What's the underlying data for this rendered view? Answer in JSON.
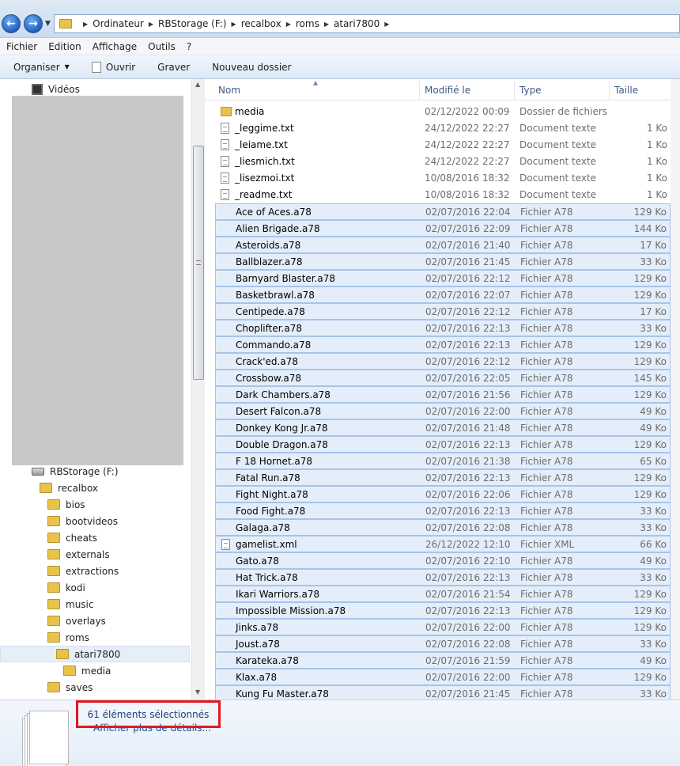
{
  "address": {
    "breadcrumbs": [
      "Ordinateur",
      "RBStorage (F:)",
      "recalbox",
      "roms",
      "atari7800"
    ]
  },
  "menu": [
    "Fichier",
    "Edition",
    "Affichage",
    "Outils",
    "?"
  ],
  "toolbar": {
    "organiser": "Organiser",
    "ouvrir": "Ouvrir",
    "graver": "Graver",
    "nouveau_dossier": "Nouveau dossier"
  },
  "tree": {
    "videos": "Vidéos",
    "drive": "RBStorage (F:)",
    "recalbox": "recalbox",
    "bios": "bios",
    "bootvideos": "bootvideos",
    "cheats": "cheats",
    "externals": "externals",
    "extractions": "extractions",
    "kodi": "kodi",
    "music": "music",
    "overlays": "overlays",
    "roms": "roms",
    "atari7800": "atari7800",
    "media": "media",
    "saves": "saves"
  },
  "columns": {
    "name": "Nom",
    "modified": "Modifié le",
    "type": "Type",
    "size": "Taille"
  },
  "files": [
    {
      "name": "media",
      "date": "02/12/2022 00:09",
      "type": "Dossier de fichiers",
      "size": "",
      "icon": "folder",
      "sel": false
    },
    {
      "name": "_leggime.txt",
      "date": "24/12/2022 22:27",
      "type": "Document texte",
      "size": "1 Ko",
      "icon": "txt",
      "sel": false
    },
    {
      "name": "_leiame.txt",
      "date": "24/12/2022 22:27",
      "type": "Document texte",
      "size": "1 Ko",
      "icon": "txt",
      "sel": false
    },
    {
      "name": "_liesmich.txt",
      "date": "24/12/2022 22:27",
      "type": "Document texte",
      "size": "1 Ko",
      "icon": "txt",
      "sel": false
    },
    {
      "name": "_lisezmoi.txt",
      "date": "10/08/2016 18:32",
      "type": "Document texte",
      "size": "1 Ko",
      "icon": "txt",
      "sel": false
    },
    {
      "name": "_readme.txt",
      "date": "10/08/2016 18:32",
      "type": "Document texte",
      "size": "1 Ko",
      "icon": "txt",
      "sel": false
    },
    {
      "name": "Ace of Aces.a78",
      "date": "02/07/2016 22:04",
      "type": "Fichier A78",
      "size": "129 Ko",
      "icon": "blank",
      "sel": true
    },
    {
      "name": "Alien Brigade.a78",
      "date": "02/07/2016 22:09",
      "type": "Fichier A78",
      "size": "144 Ko",
      "icon": "blank",
      "sel": true
    },
    {
      "name": "Asteroids.a78",
      "date": "02/07/2016 21:40",
      "type": "Fichier A78",
      "size": "17 Ko",
      "icon": "blank",
      "sel": true
    },
    {
      "name": "Ballblazer.a78",
      "date": "02/07/2016 21:45",
      "type": "Fichier A78",
      "size": "33 Ko",
      "icon": "blank",
      "sel": true
    },
    {
      "name": "Barnyard Blaster.a78",
      "date": "02/07/2016 22:12",
      "type": "Fichier A78",
      "size": "129 Ko",
      "icon": "blank",
      "sel": true
    },
    {
      "name": "Basketbrawl.a78",
      "date": "02/07/2016 22:07",
      "type": "Fichier A78",
      "size": "129 Ko",
      "icon": "blank",
      "sel": true
    },
    {
      "name": "Centipede.a78",
      "date": "02/07/2016 22:12",
      "type": "Fichier A78",
      "size": "17 Ko",
      "icon": "blank",
      "sel": true
    },
    {
      "name": "Choplifter.a78",
      "date": "02/07/2016 22:13",
      "type": "Fichier A78",
      "size": "33 Ko",
      "icon": "blank",
      "sel": true
    },
    {
      "name": "Commando.a78",
      "date": "02/07/2016 22:13",
      "type": "Fichier A78",
      "size": "129 Ko",
      "icon": "blank",
      "sel": true
    },
    {
      "name": "Crack'ed.a78",
      "date": "02/07/2016 22:12",
      "type": "Fichier A78",
      "size": "129 Ko",
      "icon": "blank",
      "sel": true
    },
    {
      "name": "Crossbow.a78",
      "date": "02/07/2016 22:05",
      "type": "Fichier A78",
      "size": "145 Ko",
      "icon": "blank",
      "sel": true
    },
    {
      "name": "Dark Chambers.a78",
      "date": "02/07/2016 21:56",
      "type": "Fichier A78",
      "size": "129 Ko",
      "icon": "blank",
      "sel": true
    },
    {
      "name": "Desert Falcon.a78",
      "date": "02/07/2016 22:00",
      "type": "Fichier A78",
      "size": "49 Ko",
      "icon": "blank",
      "sel": true
    },
    {
      "name": "Donkey Kong Jr.a78",
      "date": "02/07/2016 21:48",
      "type": "Fichier A78",
      "size": "49 Ko",
      "icon": "blank",
      "sel": true
    },
    {
      "name": "Double Dragon.a78",
      "date": "02/07/2016 22:13",
      "type": "Fichier A78",
      "size": "129 Ko",
      "icon": "blank",
      "sel": true
    },
    {
      "name": "F 18 Hornet.a78",
      "date": "02/07/2016 21:38",
      "type": "Fichier A78",
      "size": "65 Ko",
      "icon": "blank",
      "sel": true
    },
    {
      "name": "Fatal Run.a78",
      "date": "02/07/2016 22:13",
      "type": "Fichier A78",
      "size": "129 Ko",
      "icon": "blank",
      "sel": true
    },
    {
      "name": "Fight Night.a78",
      "date": "02/07/2016 22:06",
      "type": "Fichier A78",
      "size": "129 Ko",
      "icon": "blank",
      "sel": true
    },
    {
      "name": "Food Fight.a78",
      "date": "02/07/2016 22:13",
      "type": "Fichier A78",
      "size": "33 Ko",
      "icon": "blank",
      "sel": true
    },
    {
      "name": "Galaga.a78",
      "date": "02/07/2016 22:08",
      "type": "Fichier A78",
      "size": "33 Ko",
      "icon": "blank",
      "sel": true
    },
    {
      "name": "gamelist.xml",
      "date": "26/12/2022 12:10",
      "type": "Fichier XML",
      "size": "66 Ko",
      "icon": "txt",
      "sel": true
    },
    {
      "name": "Gato.a78",
      "date": "02/07/2016 22:10",
      "type": "Fichier A78",
      "size": "49 Ko",
      "icon": "blank",
      "sel": true
    },
    {
      "name": "Hat Trick.a78",
      "date": "02/07/2016 22:13",
      "type": "Fichier A78",
      "size": "33 Ko",
      "icon": "blank",
      "sel": true
    },
    {
      "name": "Ikari Warriors.a78",
      "date": "02/07/2016 21:54",
      "type": "Fichier A78",
      "size": "129 Ko",
      "icon": "blank",
      "sel": true
    },
    {
      "name": "Impossible Mission.a78",
      "date": "02/07/2016 22:13",
      "type": "Fichier A78",
      "size": "129 Ko",
      "icon": "blank",
      "sel": true
    },
    {
      "name": "Jinks.a78",
      "date": "02/07/2016 22:00",
      "type": "Fichier A78",
      "size": "129 Ko",
      "icon": "blank",
      "sel": true
    },
    {
      "name": "Joust.a78",
      "date": "02/07/2016 22:08",
      "type": "Fichier A78",
      "size": "33 Ko",
      "icon": "blank",
      "sel": true
    },
    {
      "name": "Karateka.a78",
      "date": "02/07/2016 21:59",
      "type": "Fichier A78",
      "size": "49 Ko",
      "icon": "blank",
      "sel": true
    },
    {
      "name": "Klax.a78",
      "date": "02/07/2016 22:00",
      "type": "Fichier A78",
      "size": "129 Ko",
      "icon": "blank",
      "sel": true
    },
    {
      "name": "Kung Fu Master.a78",
      "date": "02/07/2016 21:45",
      "type": "Fichier A78",
      "size": "33 Ko",
      "icon": "blank",
      "sel": true
    }
  ],
  "details": {
    "selection": "61 éléments sélectionnés",
    "more": "Afficher plus de détails..."
  },
  "colors": {
    "selection_bg": "#e4eefa",
    "selection_border": "#a6c4ea",
    "highlight_box": "#e0181f"
  }
}
